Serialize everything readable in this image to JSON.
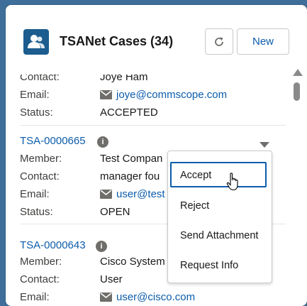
{
  "header": {
    "title": "TSANet Cases (34)",
    "new_label": "New",
    "refresh_icon": "refresh-icon",
    "app_icon": "contact-card-icon",
    "app_icon_color": "#1c5c8e"
  },
  "labels": {
    "member": "Member:",
    "contact": "Contact:",
    "email": "Email:",
    "status": "Status:"
  },
  "cases": [
    {
      "contact": "Joye Ham",
      "email": "joye@commscope.com",
      "status": "ACCEPTED"
    },
    {
      "id": "TSA-0000665",
      "member": "Test Compan",
      "contact": "manager fou",
      "email": "user@test",
      "status": "OPEN"
    },
    {
      "id": "TSA-0000643",
      "member": "Cisco System",
      "contact": "User",
      "email": "user@cisco.com"
    }
  ],
  "row_menu": {
    "items": [
      "Accept",
      "Reject",
      "Send Attachment",
      "Request Info"
    ],
    "focused": "Accept"
  },
  "colors": {
    "link": "#0b5cab",
    "background": "#3f6e9a"
  }
}
